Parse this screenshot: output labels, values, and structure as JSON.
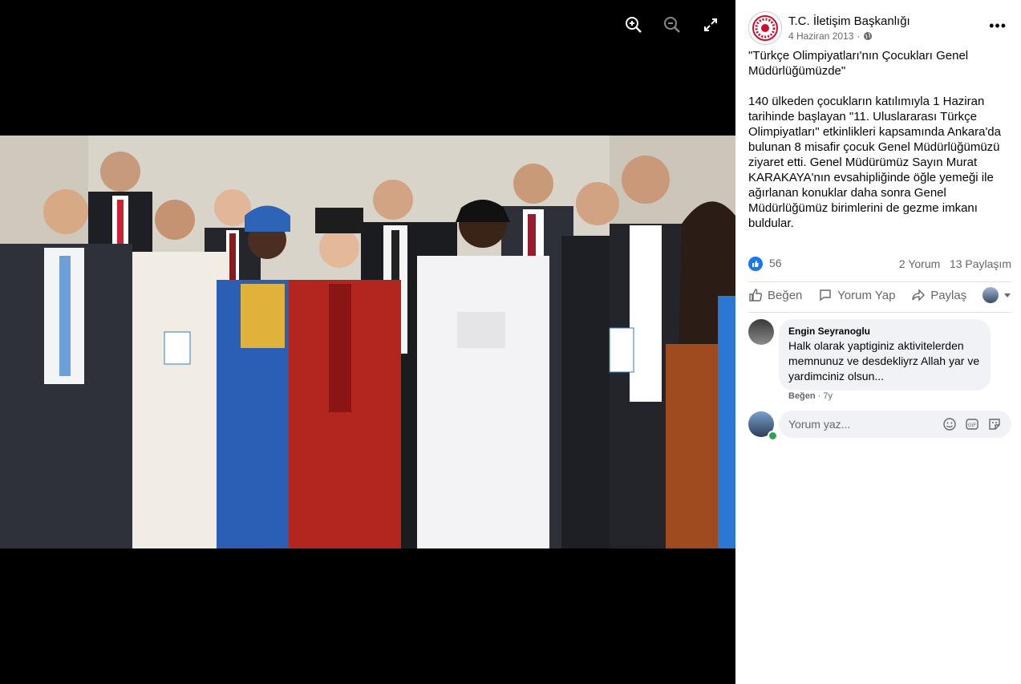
{
  "viewer": {
    "tools": [
      "zoom-in-icon",
      "zoom-out-icon",
      "fullscreen-icon"
    ]
  },
  "post": {
    "author": "T.C. İletişim Başkanlığı",
    "date": "4 Haziran 2013",
    "privacy_icon": "globe-icon",
    "text": "\"Türkçe Olimpiyatları'nın Çocukları Genel Müdürlüğümüzde\"\n\n140 ülkeden çocukların katılımıyla 1 Haziran tarihinde başlayan \"11. Uluslararası Türkçe Olimpiyatları\" etkinlikleri kapsamında Ankara'da bulunan 8 misafir çocuk Genel Müdürlüğümüzü ziyaret etti. Genel Müdürümüz Sayın Murat KARAKAYA'nın evsahipliğinde öğle yemeği ile ağırlanan konuklar daha sonra Genel Müdürlüğümüz birimlerini de gezme imkanı buldular.",
    "reactions_count": "56",
    "comments_count": "2 Yorum",
    "shares_count": "13 Paylaşım"
  },
  "actions": {
    "like": "Beğen",
    "comment": "Yorum Yap",
    "share": "Paylaş"
  },
  "comment": {
    "name": "Engin Seyranoglu",
    "text": "Halk olarak yaptiginiz aktivitelerden memnunuz ve desdekliyrz Allah yar ve yardimciniz olsun...",
    "like_label": "Beğen",
    "time": "7y"
  },
  "write_comment": {
    "placeholder": "Yorum yaz..."
  },
  "colors": {
    "accent": "#1877f2",
    "online": "#31a24c"
  }
}
